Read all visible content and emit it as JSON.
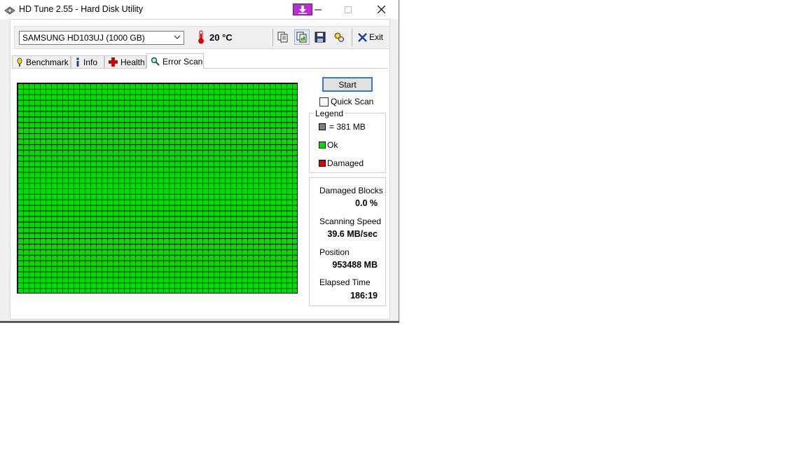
{
  "window": {
    "title": "HD Tune 2.55 - Hard Disk Utility"
  },
  "toolbar": {
    "drive": "SAMSUNG HD103UJ (1000 GB)",
    "temperature": "20 °C",
    "exit_label": "Exit",
    "buttons": [
      "copy-info-icon",
      "copy-screenshot-icon",
      "save-icon",
      "options-icon"
    ]
  },
  "tabs": [
    {
      "label": "Benchmark",
      "icon": "benchmark-icon"
    },
    {
      "label": "Info",
      "icon": "info-icon"
    },
    {
      "label": "Health",
      "icon": "health-icon"
    },
    {
      "label": "Error Scan",
      "icon": "magnifier-icon",
      "active": true
    }
  ],
  "scan": {
    "start_label": "Start",
    "quick_scan_label": "Quick Scan",
    "quick_scan_checked": false,
    "legend": {
      "title": "Legend",
      "block_size": "= 381 MB",
      "ok": "Ok",
      "damaged": "Damaged"
    },
    "block_status": "all-ok",
    "colors": {
      "ok": "#00dd00",
      "damaged": "#dd0000",
      "block": "#808080"
    },
    "stats": {
      "damaged_blocks_label": "Damaged Blocks",
      "damaged_blocks_value": "0.0 %",
      "speed_label": "Scanning Speed",
      "speed_value": "39.6 MB/sec",
      "position_label": "Position",
      "position_value": "953488 MB",
      "elapsed_label": "Elapsed Time",
      "elapsed_value": "186:19"
    }
  }
}
